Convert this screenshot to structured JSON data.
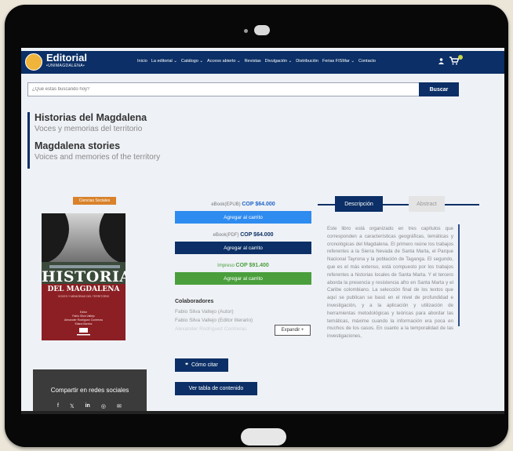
{
  "brand": {
    "name": "Editorial",
    "sub": "•UNIMAGDALENA•"
  },
  "nav": {
    "items": [
      "Inicio",
      "La editorial ⌄",
      "Catálogo ⌄",
      "Acceso abierto ⌄",
      "Revistas",
      "Divulgación ⌄",
      "Distribución",
      "Ferias FISMar ⌄",
      "Contacto"
    ]
  },
  "search": {
    "placeholder": "¿Qué estás buscando hoy?",
    "button": "Buscar"
  },
  "book": {
    "title_es": "Historias del Magdalena",
    "subtitle_es": "Voces y memorias del territorio",
    "title_en": "Magdalena stories",
    "subtitle_en": "Voices and memories of the territory",
    "category": "Ciencias Sociales",
    "cover": {
      "title": "HISTORIAS",
      "subtitle": "DEL MAGDALENA",
      "tagline": "VOCES Y MEMORIAS DEL TERRITORIO",
      "editors_label": "Editor",
      "authors": [
        "Fabio Silva Vallejo",
        "Alexander Rodríguez Contreras",
        "Eliana Barrios"
      ],
      "publisher": "Editorial"
    }
  },
  "formats": [
    {
      "label": "eBook(EPUB)",
      "price": "COP $64.000",
      "button": "Agregar al carrito",
      "color": "#2e8bf0"
    },
    {
      "label": "eBook(PDF)",
      "price": "COP $64.000",
      "button": "Agregar al carrito",
      "color": "#0b2f66"
    },
    {
      "label": "Impreso",
      "price": "COP $91.400",
      "button": "Agregar al carrito",
      "color": "#4a9f3c"
    }
  ],
  "collaborators": {
    "heading": "Colaboradores",
    "list": [
      "Fabio Silva Vallejo (Autor)",
      "Fabio Silva Vallejo (Editor literario)",
      "Alexander Rodríguez Contreras"
    ],
    "expand": "Expandir +"
  },
  "actions": {
    "cite": "Cómo citar",
    "toc": "Ver tabla de contenido"
  },
  "share": {
    "title": "Compartir en redes sociales"
  },
  "tabs": {
    "description": "Descripción",
    "abstract": "Abstract"
  },
  "description": "Este libro está organizado en tres capítulos que corresponden a características geográficas, temáticas y cronológicas del Magdalena. El primero reúne los trabajos referentes a la Sierra Nevada de Santa Marta, el Parque Nacional Tayrona y la población de Taganga. El segundo, que es el más extenso, está compuesto por los trabajos referentes a historias locales de Santa Marta. Y el tercero aborda la presencia y resistencia afro en Santa Marta y el Caribe colombiano. La selección final de los textos que aquí se publican se basó en el nivel de profundidad e investigación, y a la aplicación y utilización de herramientas metodológicas y teóricas para abordar las temáticas, máxime cuando la información era poca en muchos de los casos. En cuanto a la temporalidad de las investigaciones,",
  "colors": {
    "primary": "#0b2f66",
    "accent": "#1e63c8",
    "green": "#4a9f3c",
    "category": "#d9822b"
  }
}
